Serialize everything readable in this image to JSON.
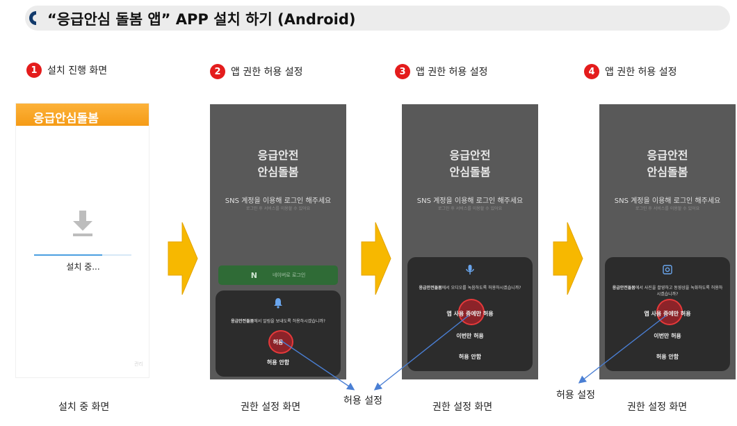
{
  "title": {
    "text": "“응급안심 돌봄 앱” APP 설치 하기 (Android)",
    "icon": "half-circle-bullet-icon"
  },
  "steps": [
    {
      "num": "1",
      "label": "설치 진행 화면",
      "caption": "설치 중 화면"
    },
    {
      "num": "2",
      "label": "앱 권한 허용 설정",
      "caption": "권한 설정 화면"
    },
    {
      "num": "3",
      "label": "앱 권한 허용 설정",
      "caption": "권한 설정 화면"
    },
    {
      "num": "4",
      "label": "앱 권한 허용 설정",
      "caption": "권한 설정 화면"
    }
  ],
  "screen1": {
    "header": "응급안심돌봄",
    "status": "설치 중...",
    "download_icon": "download-icon",
    "progress": 0.7,
    "watermark": "관리"
  },
  "phone_common": {
    "app_name_line1": "응급안전",
    "app_name_line2": "안심돌봄",
    "login_prompt": "SNS 계정을 이용해 로그인 해주세요",
    "login_subtle": "로그인 후 서비스를 이용할 수 있어요"
  },
  "screen2": {
    "naver_letter": "N",
    "naver_label": "네이버로 로그인",
    "dialog_icon": "bell-icon",
    "dialog_app": "응급안전돌봄",
    "dialog_text": "에서 알림을 보내도록 허용하시겠습니까?",
    "options": [
      "허용",
      "허용 안함"
    ]
  },
  "screen3": {
    "dialog_icon": "microphone-icon",
    "dialog_app": "응급안전돌봄",
    "dialog_text": "에서 오디오를 녹음하도록 허용하시겠습니까?",
    "options": [
      "앱 사용 중에만 허용",
      "이번만 허용",
      "허용 안함"
    ]
  },
  "screen4": {
    "dialog_icon": "camera-icon",
    "dialog_app": "응급안전돌봄",
    "dialog_text": "에서 사진을 촬영하고 동영상을 녹화하도록 허용하시겠습니까?",
    "options": [
      "앱 사용 중에만 허용",
      "이번만 허용",
      "허용 안함"
    ]
  },
  "callouts": {
    "allow_setting_1": "허용 설정",
    "allow_setting_2": "허용 설정"
  },
  "colors": {
    "step_badge": "#e41c1c",
    "header_orange": "#f59b16",
    "arrow_yellow": "#f7b800",
    "callout_line": "#4a7fd4",
    "phone_bg": "#595959",
    "dialog_bg": "#2c2c2c"
  }
}
